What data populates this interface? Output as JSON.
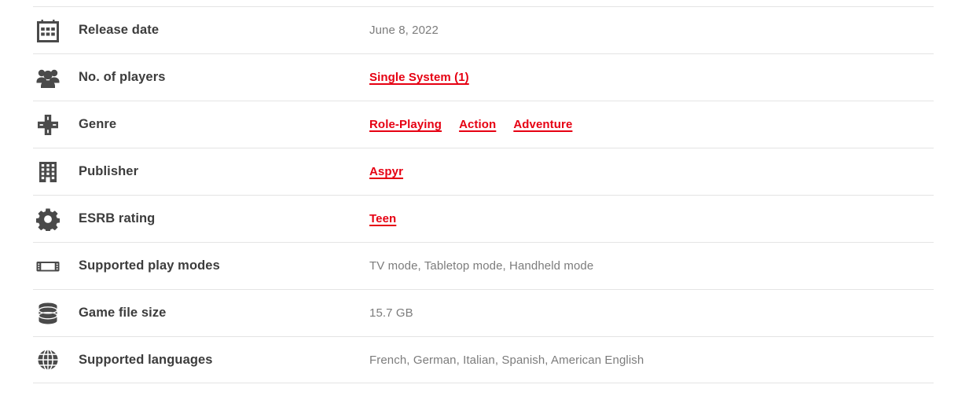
{
  "spec_table": {
    "link_color": "#e60012",
    "label_color": "#3c3c3c",
    "value_color": "#7c7c7c",
    "divider_color": "#e4e4e4",
    "rows": [
      {
        "icon": "calendar-icon",
        "label": "Release date",
        "value_type": "text",
        "value": "June 8, 2022"
      },
      {
        "icon": "players-group-icon",
        "label": "No. of players",
        "value_type": "links",
        "links": [
          "Single System (1)"
        ]
      },
      {
        "icon": "dpad-icon",
        "label": "Genre",
        "value_type": "links",
        "links": [
          "Role-Playing",
          "Action",
          "Adventure"
        ]
      },
      {
        "icon": "building-icon",
        "label": "Publisher",
        "value_type": "links",
        "links": [
          "Aspyr"
        ]
      },
      {
        "icon": "gear-icon",
        "label": "ESRB rating",
        "value_type": "links",
        "links": [
          "Teen"
        ]
      },
      {
        "icon": "handheld-console-icon",
        "label": "Supported play modes",
        "value_type": "text",
        "value": "TV mode, Tabletop mode, Handheld mode"
      },
      {
        "icon": "database-icon",
        "label": "Game file size",
        "value_type": "text",
        "value": "15.7 GB"
      },
      {
        "icon": "globe-icon",
        "label": "Supported languages",
        "value_type": "text",
        "value": "French, German, Italian, Spanish, American English"
      }
    ]
  }
}
